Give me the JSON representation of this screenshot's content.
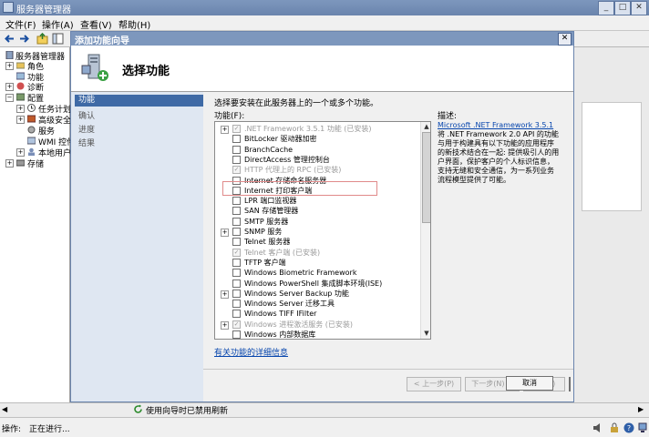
{
  "main_window": {
    "title": "服务器管理器",
    "caption_buttons": [
      "_",
      "□",
      "✕"
    ]
  },
  "menu": [
    "文件(F)",
    "操作(A)",
    "查看(V)",
    "帮助(H)"
  ],
  "tree": {
    "root": "服务器管理器",
    "items": [
      {
        "label": "角色"
      },
      {
        "label": "功能"
      },
      {
        "label": "诊断"
      },
      {
        "label": "配置"
      },
      {
        "label": "任务计划"
      },
      {
        "label": "高级安全"
      },
      {
        "label": "服务"
      },
      {
        "label": "WMI 控件"
      },
      {
        "label": "本地用户"
      },
      {
        "label": "存储"
      }
    ]
  },
  "dialog": {
    "title": "添加功能向导",
    "header": "选择功能",
    "steps": [
      "功能",
      "确认",
      "进度",
      "结果"
    ],
    "instruction": "选择要安装在此服务器上的一个或多个功能。",
    "features_label": "功能(F):",
    "features": [
      {
        "label": ".NET Framework 3.5.1 功能  (已安装)",
        "expand": "+",
        "checked": "✓",
        "disabled": true
      },
      {
        "label": "BitLocker 驱动器加密",
        "expand": "",
        "checked": "",
        "disabled": false
      },
      {
        "label": "BranchCache",
        "expand": "",
        "checked": "",
        "disabled": false
      },
      {
        "label": "DirectAccess 管理控制台",
        "expand": "",
        "checked": "",
        "disabled": false
      },
      {
        "label": "HTTP 代理上的 RPC  (已安装)",
        "expand": "",
        "checked": "✓",
        "disabled": true
      },
      {
        "label": "Internet 存储命名服务器",
        "expand": "",
        "checked": "",
        "disabled": false
      },
      {
        "label": "Internet 打印客户端",
        "expand": "",
        "checked": "",
        "disabled": false
      },
      {
        "label": "LPR 端口监视器",
        "expand": "",
        "checked": "",
        "disabled": false
      },
      {
        "label": "SAN 存储管理器",
        "expand": "",
        "checked": "",
        "disabled": false
      },
      {
        "label": "SMTP 服务器",
        "expand": "",
        "checked": "",
        "disabled": false
      },
      {
        "label": "SNMP 服务",
        "expand": "+",
        "checked": "",
        "disabled": false
      },
      {
        "label": "Telnet 服务器",
        "expand": "",
        "checked": "",
        "disabled": false
      },
      {
        "label": "Telnet 客户端  (已安装)",
        "expand": "",
        "checked": "✓",
        "disabled": true
      },
      {
        "label": "TFTP 客户端",
        "expand": "",
        "checked": "",
        "disabled": false
      },
      {
        "label": "Windows Biometric Framework",
        "expand": "",
        "checked": "",
        "disabled": false
      },
      {
        "label": "Windows PowerShell 集成脚本环境(ISE)",
        "expand": "",
        "checked": "",
        "disabled": false
      },
      {
        "label": "Windows Server Backup 功能",
        "expand": "+",
        "checked": "",
        "disabled": false
      },
      {
        "label": "Windows Server 迁移工具",
        "expand": "",
        "checked": "",
        "disabled": false
      },
      {
        "label": "Windows TIFF IFilter",
        "expand": "",
        "checked": "",
        "disabled": false
      },
      {
        "label": "Windows 进程激活服务  (已安装)",
        "expand": "+",
        "checked": "✓",
        "disabled": true
      },
      {
        "label": "Windows 内部数据库",
        "expand": "",
        "checked": "",
        "disabled": false
      }
    ],
    "more_info_link": "有关功能的详细信息",
    "description_title": "描述:",
    "description_link": "Microsoft .NET Framework 3.5.1",
    "description_text": "将 .NET Framework 2.0 API 的功能与用于构建具有以下功能的应用程序的新技术结合在一起: 提供吸引人的用户界面，保护客户的个人标识信息，支持无缝和安全通信，为一系列业务流程模型提供了可能。",
    "buttons": {
      "prev": "< 上一步(P)",
      "next": "下一步(N) >",
      "install": "安装(I)",
      "cancel": "取消"
    }
  },
  "bottom": {
    "refresh_note": "使用向导时已禁用刷新",
    "status_label": "操作:",
    "status_value": "正在进行..."
  }
}
